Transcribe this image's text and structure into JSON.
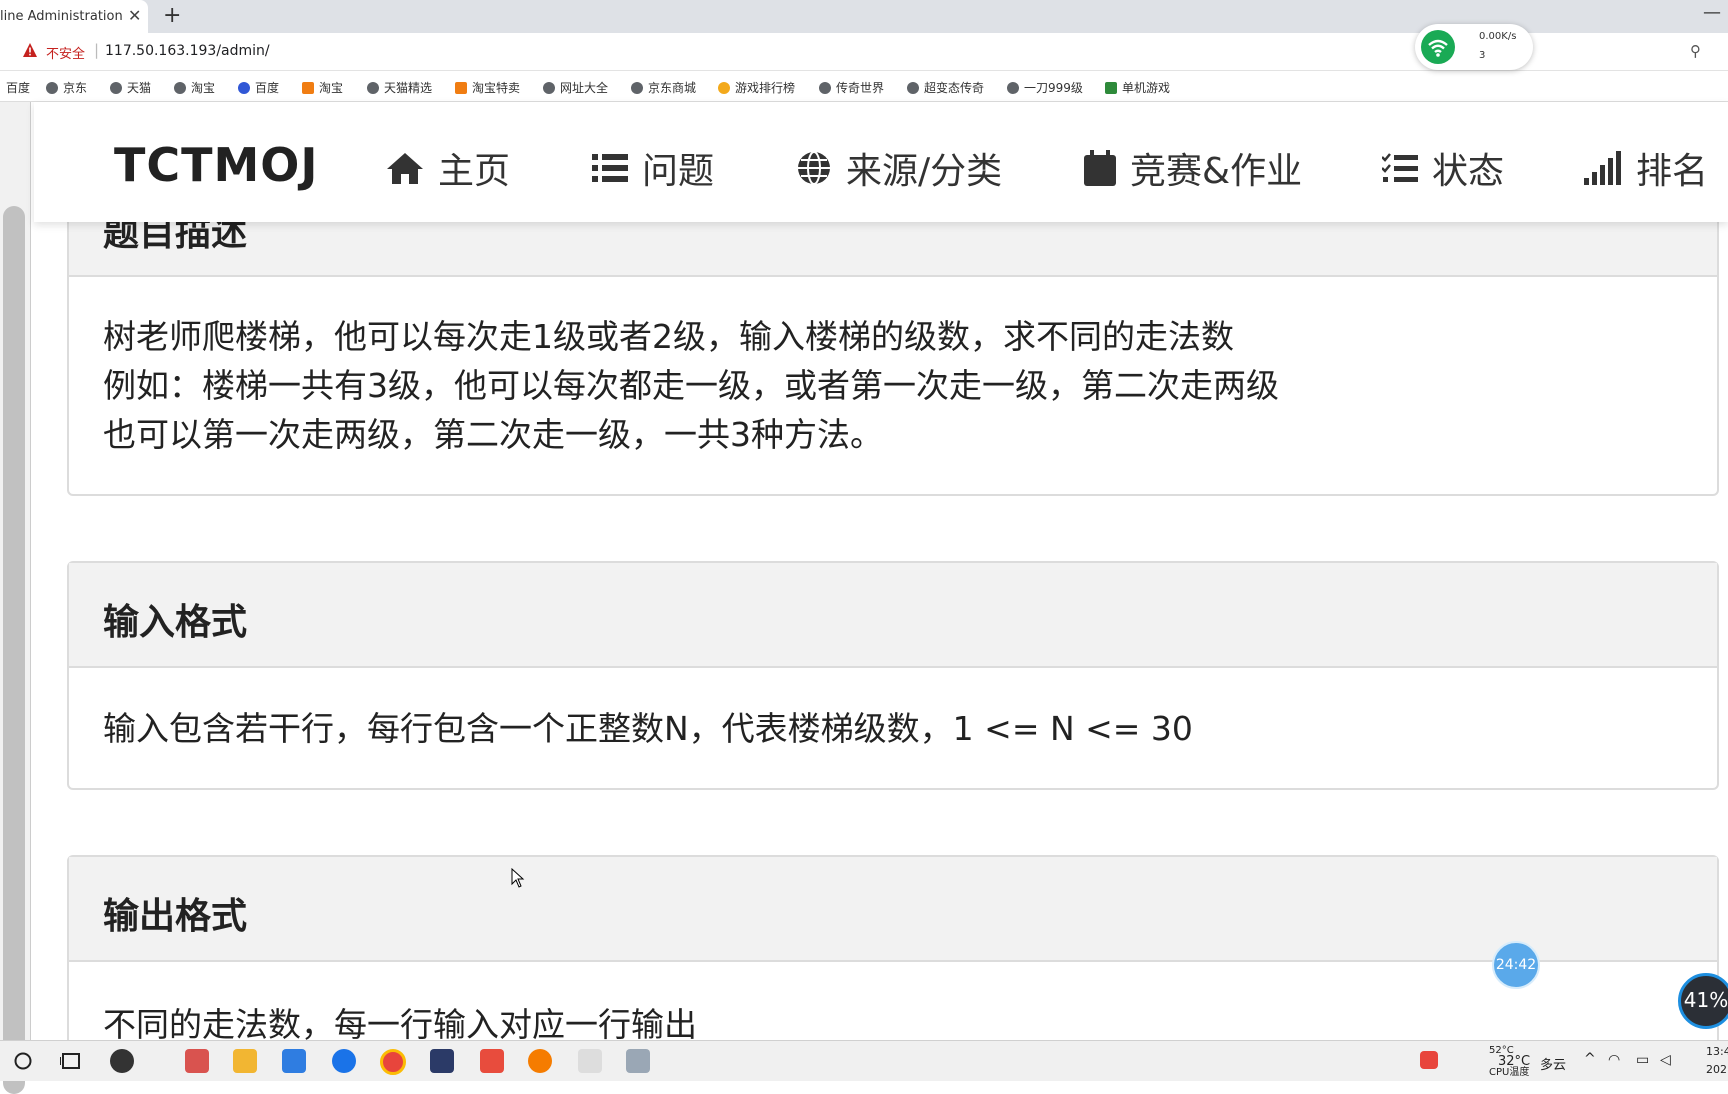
{
  "browser": {
    "tab_title": "line Administration",
    "tab_close": "✕",
    "new_tab": "+",
    "minimize": "—",
    "insecure_label": "不安全",
    "url": "117.50.163.193/admin/",
    "bookmarks": [
      "百度",
      "京东",
      "天猫",
      "淘宝",
      "百度",
      "淘宝",
      "天猫精选",
      "淘宝特卖",
      "网址大全",
      "京东商城",
      "游戏排行榜",
      "传奇世界",
      "超变态传奇",
      "一刀999级",
      "单机游戏"
    ]
  },
  "net_widget": {
    "speed": "0.00K/s",
    "count": "3"
  },
  "navbar": {
    "brand": "TCTMOJ",
    "items": [
      {
        "icon": "home-icon",
        "label": "主页"
      },
      {
        "icon": "list-icon",
        "label": "问题"
      },
      {
        "icon": "globe-icon",
        "label": "来源/分类"
      },
      {
        "icon": "calendar-icon",
        "label": "竞赛&作业"
      },
      {
        "icon": "checklist-icon",
        "label": "状态"
      },
      {
        "icon": "signal-bars-icon",
        "label": "排名"
      }
    ]
  },
  "sections": {
    "description": {
      "title": "题目描述",
      "lines": [
        "树老师爬楼梯，他可以每次走1级或者2级，输入楼梯的级数，求不同的走法数",
        "例如：楼梯一共有3级，他可以每次都走一级，或者第一次走一级，第二次走两级",
        "也可以第一次走两级，第二次走一级，一共3种方法。"
      ]
    },
    "input": {
      "title": "输入格式",
      "text": "输入包含若干行，每行包含一个正整数N，代表楼梯级数，1 <= N <= 30"
    },
    "output": {
      "title": "输出格式",
      "text": "不同的走法数，每一行输入对应一行输出"
    }
  },
  "overlays": {
    "timer": "24:42",
    "gauge": "41%"
  },
  "taskbar": {
    "weather_temp": "32°C",
    "weather_desc": "多云",
    "cpu_temp": "52°C",
    "cpu_label": "CPU温度",
    "time": "13:4",
    "date": "202"
  }
}
